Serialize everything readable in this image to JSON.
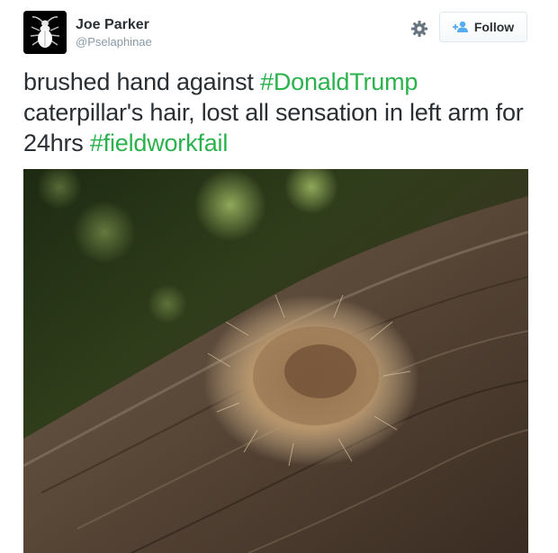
{
  "user": {
    "display_name": "Joe Parker",
    "handle": "@Pselaphinae",
    "avatar_icon": "beetle-icon"
  },
  "actions": {
    "settings_icon": "gear-icon",
    "follow_icon": "add-user-icon",
    "follow_label": "Follow"
  },
  "tweet": {
    "text_1": "brushed hand against ",
    "hashtag_1": "#DonaldTrump",
    "text_2": " caterpillar's hair, lost all sensation in left arm for 24hrs ",
    "hashtag_2": "#fieldworkfail"
  },
  "colors": {
    "hashtag": "#2bb24c",
    "text": "#292f33",
    "secondary": "#8899a6"
  }
}
